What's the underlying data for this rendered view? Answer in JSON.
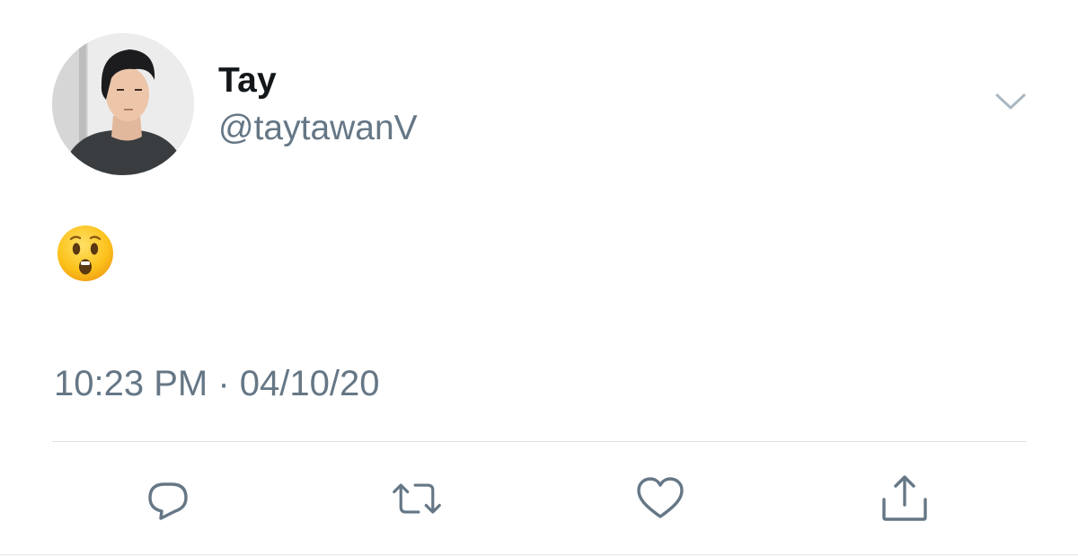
{
  "author": {
    "name": "Tay",
    "handle": "@taytawanV"
  },
  "tweet": {
    "emoji": "hushed-face",
    "time": "10:23 PM",
    "separator": "·",
    "date": "04/10/20"
  },
  "actions": [
    {
      "icon": "reply-icon"
    },
    {
      "icon": "retweet-icon"
    },
    {
      "icon": "like-icon"
    },
    {
      "icon": "share-icon"
    }
  ],
  "colors": {
    "name": "#14171a",
    "secondary": "#657786",
    "icon": "#657786",
    "divider": "#dcdfe2"
  }
}
